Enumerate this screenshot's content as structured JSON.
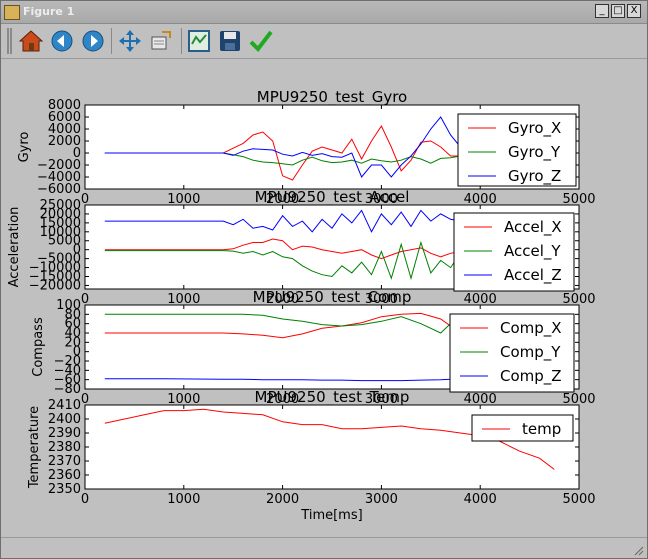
{
  "window": {
    "title": "Figure 1",
    "buttons": [
      "_",
      "□",
      "X"
    ]
  },
  "toolbar": {
    "buttons": [
      "home",
      "back",
      "forward",
      "pan",
      "zoom",
      "configure-subplots",
      "save",
      "check"
    ]
  },
  "colors": {
    "red": "#ff0000",
    "green": "#008000",
    "blue": "#0000ff"
  },
  "chart_data": [
    {
      "type": "line",
      "title": "MPU9250_test_Gyro",
      "ylabel": "Gyro",
      "xlabel": "",
      "xlim": [
        0,
        5000
      ],
      "ylim": [
        -6000,
        8000
      ],
      "xticks": [
        0,
        1000,
        2000,
        3000,
        4000,
        5000
      ],
      "yticks": [
        -6000,
        -4000,
        -2000,
        0,
        2000,
        4000,
        6000,
        8000
      ],
      "legend": "upper right",
      "x": [
        200,
        800,
        1400,
        1500,
        1600,
        1700,
        1800,
        1900,
        2000,
        2100,
        2200,
        2300,
        2400,
        2500,
        2600,
        2700,
        2800,
        2900,
        3000,
        3100,
        3200,
        3300,
        3400,
        3500,
        3600,
        3700,
        3800,
        3900,
        4000
      ],
      "series": [
        {
          "name": "Gyro_X",
          "color": "#ff0000",
          "values": [
            0,
            0,
            0,
            800,
            1600,
            3000,
            3500,
            2000,
            -3800,
            -4500,
            -2000,
            300,
            1000,
            500,
            0,
            2300,
            -1000,
            2000,
            4500,
            1000,
            -3000,
            -1200,
            1800,
            2000,
            1000,
            -500,
            -500,
            0,
            0
          ]
        },
        {
          "name": "Gyro_Y",
          "color": "#008000",
          "values": [
            0,
            0,
            0,
            -300,
            -600,
            -1200,
            -1500,
            -1600,
            -1800,
            -2000,
            -1200,
            -700,
            -1300,
            -1600,
            -1500,
            -1200,
            -1700,
            -1000,
            -1300,
            -1500,
            -1200,
            -600,
            -1000,
            -1700,
            -900,
            -800,
            -500,
            0,
            0
          ]
        },
        {
          "name": "Gyro_Z",
          "color": "#0000ff",
          "values": [
            0,
            0,
            0,
            -400,
            300,
            700,
            600,
            500,
            -200,
            -500,
            100,
            -400,
            -100,
            -600,
            -700,
            0,
            -4000,
            -2000,
            -2000,
            -4000,
            -2000,
            -500,
            1500,
            4000,
            6000,
            3000,
            1000,
            0,
            0
          ]
        }
      ]
    },
    {
      "type": "line",
      "title": "MPU9250_test_Accel",
      "ylabel": "Acceleration",
      "xlabel": "",
      "xlim": [
        0,
        5000
      ],
      "ylim": [
        -22000,
        25000
      ],
      "xticks": [
        0,
        1000,
        2000,
        3000,
        4000,
        5000
      ],
      "yticks": [
        -20000,
        -15000,
        -10000,
        -5000,
        0,
        5000,
        10000,
        15000,
        20000,
        25000
      ],
      "legend": "upper right",
      "x": [
        200,
        800,
        1400,
        1500,
        1600,
        1700,
        1800,
        1900,
        2000,
        2100,
        2200,
        2300,
        2400,
        2500,
        2600,
        2700,
        2800,
        2900,
        3000,
        3100,
        3200,
        3300,
        3400,
        3500,
        3600,
        3700,
        3800,
        3900,
        4000
      ],
      "series": [
        {
          "name": "Accel_X",
          "color": "#ff0000",
          "values": [
            0,
            0,
            0,
            500,
            2500,
            4000,
            4000,
            6000,
            5000,
            0,
            2000,
            1500,
            0,
            -1000,
            -2000,
            -1000,
            0,
            -3000,
            -5000,
            -3000,
            -1000,
            0,
            1000,
            -2000,
            -4000,
            -2000,
            -1000,
            0,
            0
          ]
        },
        {
          "name": "Accel_Y",
          "color": "#008000",
          "values": [
            -500,
            -500,
            -500,
            -800,
            -2000,
            -1000,
            -3000,
            -1000,
            -4000,
            -5000,
            -9000,
            -12000,
            -14000,
            -15000,
            -9000,
            -13000,
            -7000,
            -14000,
            -1000,
            -16000,
            3000,
            -16000,
            4000,
            -13000,
            -6000,
            -10000,
            -2000,
            -1000,
            -1000
          ]
        },
        {
          "name": "Accel_Z",
          "color": "#0000ff",
          "values": [
            16000,
            16000,
            16000,
            14000,
            17000,
            12000,
            13000,
            11000,
            19000,
            13000,
            16000,
            10000,
            17000,
            12000,
            20000,
            15000,
            22000,
            10000,
            20000,
            14000,
            21000,
            13000,
            22000,
            16000,
            20000,
            17000,
            16000,
            16000,
            16000
          ]
        }
      ]
    },
    {
      "type": "line",
      "title": "MPU9250_test_Comp",
      "ylabel": "Compass",
      "xlabel": "",
      "xlim": [
        0,
        5000
      ],
      "ylim": [
        -80,
        100
      ],
      "xticks": [
        0,
        1000,
        2000,
        3000,
        4000,
        5000
      ],
      "yticks": [
        -80,
        -60,
        -40,
        -20,
        0,
        20,
        40,
        60,
        80,
        100
      ],
      "legend": "upper right",
      "x": [
        200,
        800,
        1400,
        1600,
        1800,
        2000,
        2200,
        2400,
        2600,
        2800,
        3000,
        3200,
        3400,
        3600,
        3800,
        4000
      ],
      "series": [
        {
          "name": "Comp_X",
          "color": "#ff0000",
          "values": [
            40,
            40,
            40,
            38,
            35,
            30,
            38,
            50,
            55,
            62,
            75,
            80,
            82,
            70,
            40,
            40
          ]
        },
        {
          "name": "Comp_Y",
          "color": "#008000",
          "values": [
            80,
            80,
            80,
            80,
            78,
            70,
            65,
            58,
            55,
            58,
            65,
            75,
            60,
            40,
            80,
            80
          ]
        },
        {
          "name": "Comp_Z",
          "color": "#0000ff",
          "values": [
            -58,
            -58,
            -59,
            -59,
            -60,
            -60,
            -60,
            -61,
            -61,
            -62,
            -62,
            -62,
            -61,
            -60,
            -58,
            -58
          ]
        }
      ]
    },
    {
      "type": "line",
      "title": "MPU9250_test_Temp",
      "ylabel": "Temperature",
      "xlabel": "Time[ms]",
      "xlim": [
        0,
        5000
      ],
      "ylim": [
        2350,
        2410
      ],
      "xticks": [
        0,
        1000,
        2000,
        3000,
        4000,
        5000
      ],
      "yticks": [
        2350,
        2360,
        2370,
        2380,
        2390,
        2400,
        2410
      ],
      "legend": "upper right",
      "x": [
        200,
        400,
        600,
        800,
        1000,
        1200,
        1400,
        1600,
        1800,
        2000,
        2200,
        2400,
        2600,
        2800,
        3000,
        3200,
        3400,
        3600,
        3800,
        4000,
        4200,
        4400,
        4600,
        4750
      ],
      "series": [
        {
          "name": "temp",
          "color": "#ff0000",
          "values": [
            2397,
            2400,
            2403,
            2406,
            2406,
            2407,
            2405,
            2404,
            2403,
            2398,
            2396,
            2396,
            2393,
            2393,
            2394,
            2395,
            2393,
            2392,
            2390,
            2388,
            2384,
            2377,
            2372,
            2364
          ]
        }
      ]
    }
  ]
}
